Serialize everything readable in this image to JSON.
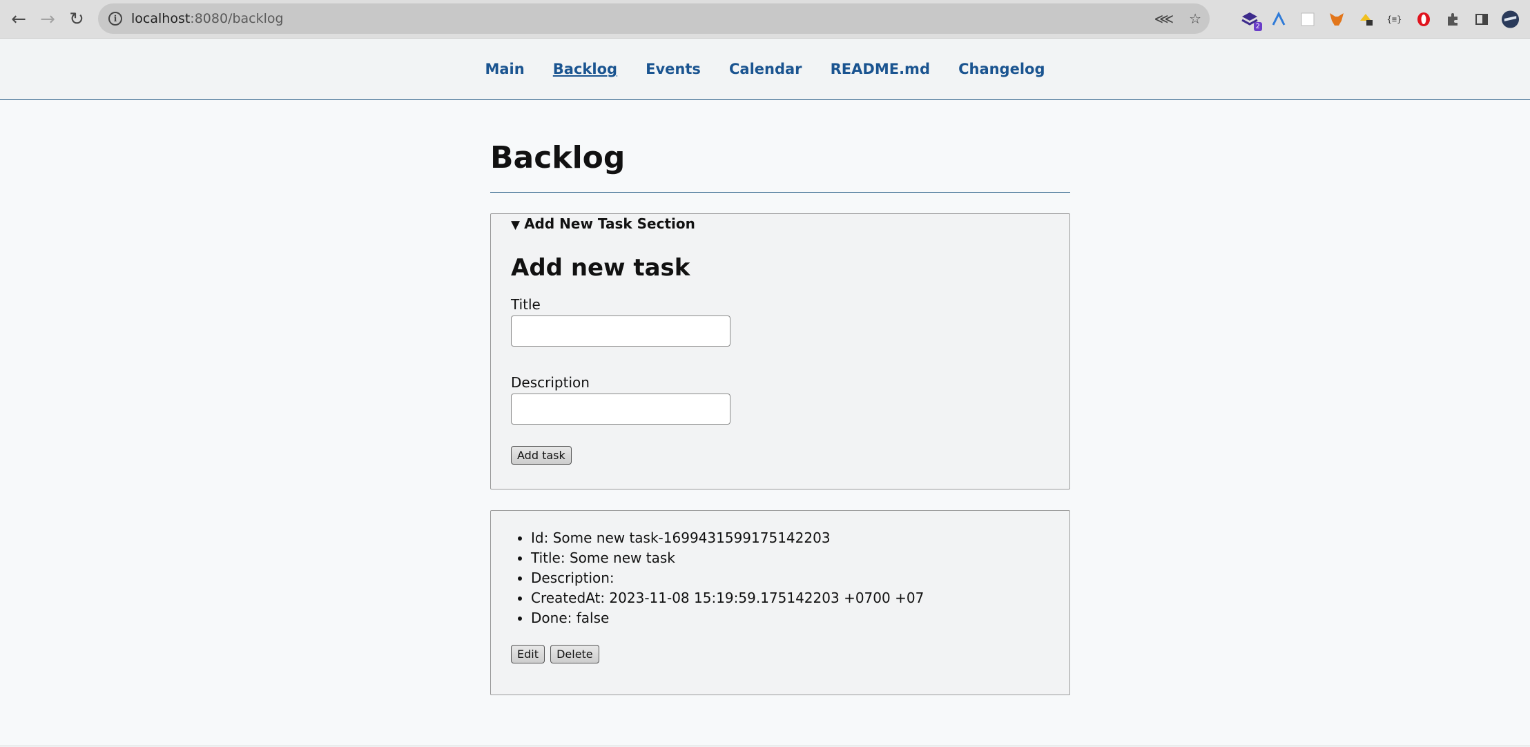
{
  "browser": {
    "url_host": "localhost",
    "url_rest": ":8080/backlog",
    "extension_badge": "2"
  },
  "nav": {
    "items": [
      "Main",
      "Backlog",
      "Events",
      "Calendar",
      "README.md",
      "Changelog"
    ],
    "active": "Backlog"
  },
  "page": {
    "title": "Backlog"
  },
  "add_section": {
    "summary": "Add New Task Section",
    "heading": "Add new task",
    "title_label": "Title",
    "title_value": "",
    "description_label": "Description",
    "description_value": "",
    "submit_label": "Add task"
  },
  "tasks": [
    {
      "lines": [
        "Id: Some new task-1699431599175142203",
        "Title: Some new task",
        "Description:",
        "CreatedAt: 2023-11-08 15:19:59.175142203 +0700 +07",
        "Done: false"
      ],
      "edit_label": "Edit",
      "delete_label": "Delete"
    }
  ]
}
